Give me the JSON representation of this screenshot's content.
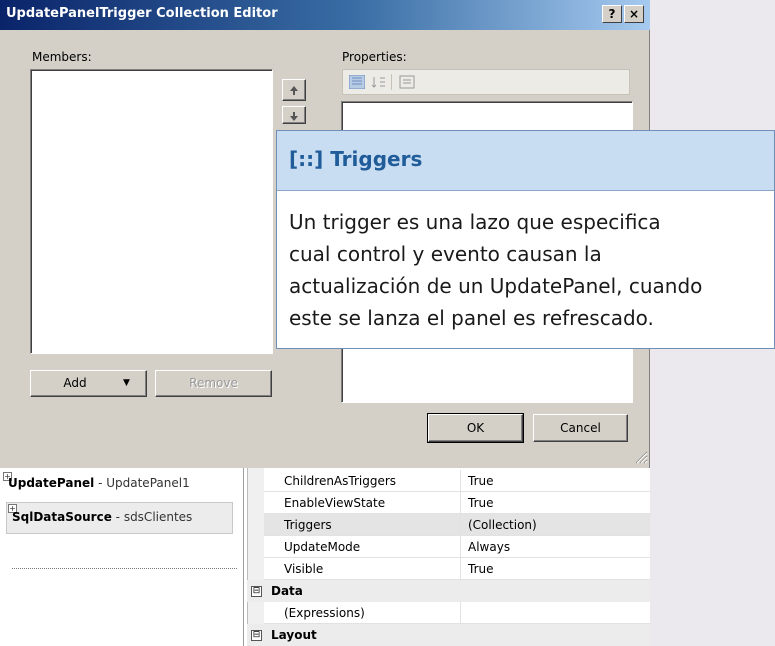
{
  "dialog": {
    "title": "UpdatePanelTrigger Collection Editor",
    "help_button": "?",
    "close_button": "×",
    "members_label": "Members:",
    "properties_label": "Properties:",
    "add_button": "Add",
    "remove_button": "Remove",
    "ok_button": "OK",
    "cancel_button": "Cancel"
  },
  "tooltip": {
    "title": "[::] Triggers",
    "lines": [
      "Un trigger es una lazo que especifica",
      "cual control y evento causan la",
      "actualización de un UpdatePanel, cuando",
      "este se lanza el panel es refrescado."
    ]
  },
  "component_tray": {
    "items": [
      {
        "type": "UpdatePanel",
        "separator": " - ",
        "id": "UpdatePanel1"
      },
      {
        "type": "SqlDataSource",
        "separator": " - ",
        "id": "sdsClientes"
      }
    ]
  },
  "property_grid": {
    "rows": [
      {
        "name": "ChildrenAsTriggers",
        "value": "True"
      },
      {
        "name": "EnableViewState",
        "value": "True"
      },
      {
        "name": "Triggers",
        "value": "(Collection)"
      },
      {
        "name": "UpdateMode",
        "value": "Always"
      },
      {
        "name": "Visible",
        "value": "True"
      }
    ],
    "category_data": "Data",
    "expressions_row": "(Expressions)",
    "category_layout": "Layout",
    "expand_glyph": "⊟"
  },
  "colors": {
    "title_gradient_start": "#0a246a",
    "title_gradient_end": "#a6caf0",
    "dialog_face": "#d4d0c8",
    "tooltip_header": "#c8ddf2",
    "tooltip_title": "#1f5c99",
    "selected_row": "#e4e4e4"
  }
}
